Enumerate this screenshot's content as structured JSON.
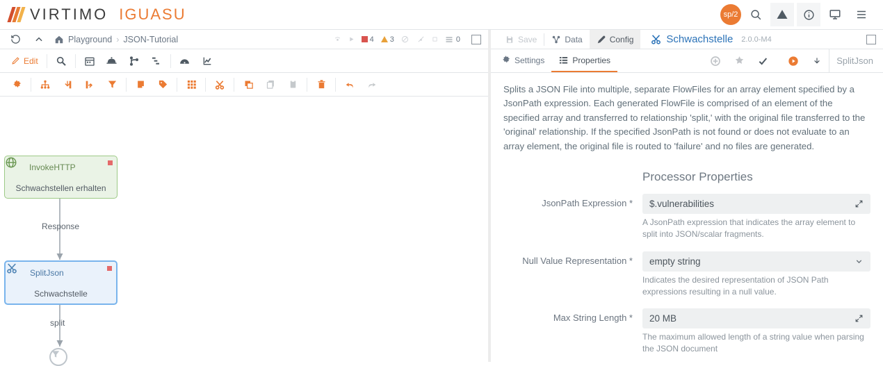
{
  "header": {
    "brand_main": "VIRTIMO",
    "brand_product": "IGUASU",
    "user_chip": "sp/2"
  },
  "left": {
    "breadcrumb": {
      "root": "Playground",
      "current": "JSON-Tutorial"
    },
    "status": {
      "running": "4",
      "invalid": "3",
      "queued_label": "0"
    },
    "edit_label": "Edit",
    "canvas": {
      "node1": {
        "title": "InvokeHTTP",
        "sub": "Schwachstellen erhalten"
      },
      "edge1": "Response",
      "node2": {
        "title": "SplitJson",
        "sub": "Schwachstelle"
      },
      "edge2": "split"
    }
  },
  "right": {
    "save": "Save",
    "data": "Data",
    "config": "Config",
    "proc_name": "Schwachstelle",
    "proc_version": "2.0.0-M4",
    "tab_settings": "Settings",
    "tab_properties": "Properties",
    "processor_type": "SplitJson",
    "description": "Splits a JSON File into multiple, separate FlowFiles for an array element specified by a JsonPath expression. Each generated FlowFile is comprised of an element of the specified array and transferred to relationship 'split,' with the original file transferred to the 'original' relationship. If the specified JsonPath is not found or does not evaluate to an array element, the original file is routed to 'failure' and no files are generated.",
    "section_title": "Processor Properties",
    "props": {
      "jsonpath": {
        "label": "JsonPath Expression *",
        "value": "$.vulnerabilities",
        "help": "A JsonPath expression that indicates the array element to split into JSON/scalar fragments."
      },
      "nullrep": {
        "label": "Null Value Representation *",
        "value": "empty string",
        "help": "Indicates the desired representation of JSON Path expressions resulting in a null value."
      },
      "maxlen": {
        "label": "Max String Length *",
        "value": "20 MB",
        "help": "The maximum allowed length of a string value when parsing the JSON document"
      }
    }
  }
}
